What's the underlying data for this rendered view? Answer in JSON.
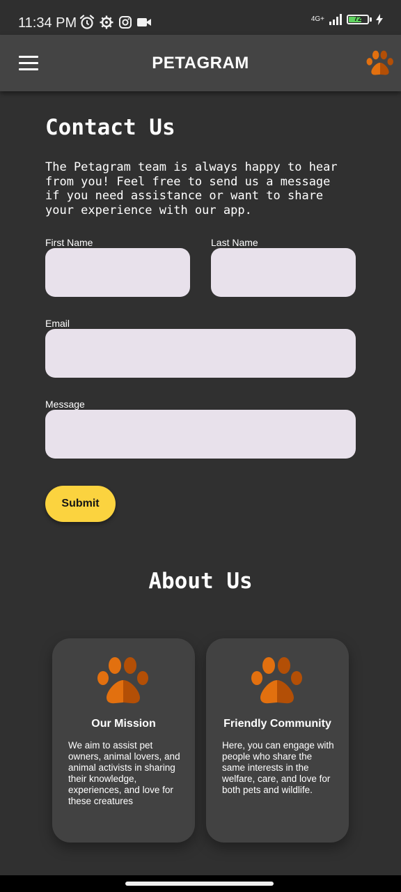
{
  "status_bar": {
    "time": "11:34 PM",
    "network": "4G+",
    "battery_level": "72",
    "battery_fraction": 0.72,
    "icons_left": [
      "alarm-icon",
      "settings-gear-icon",
      "instagram-icon",
      "video-camera-icon"
    ],
    "icons_right": [
      "signal-icon",
      "battery-icon",
      "charging-icon"
    ]
  },
  "app_bar": {
    "title": "PETAGRAM",
    "menu_icon": "hamburger-menu-icon",
    "logo_icon": "paw-icon"
  },
  "contact": {
    "title": "Contact Us",
    "intro": "The Petagram team is always happy to hear from you! Feel free to send us a message if you need assistance or want to share your experience with our app.",
    "fields": {
      "first_name": {
        "label": "First Name",
        "value": ""
      },
      "last_name": {
        "label": "Last Name",
        "value": ""
      },
      "email": {
        "label": "Email",
        "value": ""
      },
      "message": {
        "label": "Message",
        "value": ""
      }
    },
    "submit_label": "Submit"
  },
  "about": {
    "title": "About Us",
    "cards": [
      {
        "icon": "paw-icon",
        "title": "Our Mission",
        "text": "We aim to assist pet owners, animal lovers, and animal activists in sharing their knowledge, experiences, and love for these creatures"
      },
      {
        "icon": "paw-icon",
        "title": "Friendly Community",
        "text": "Here, you can engage with people who share the same interests in the welfare, care, and love for both pets and wildlife."
      }
    ]
  },
  "colors": {
    "background": "#303030",
    "app_bar": "#444444",
    "card": "#424242",
    "input": "#e8e1eb",
    "accent_button": "#fbd33f",
    "paw_orange": "#e2700f",
    "paw_dark": "#b34f06"
  }
}
